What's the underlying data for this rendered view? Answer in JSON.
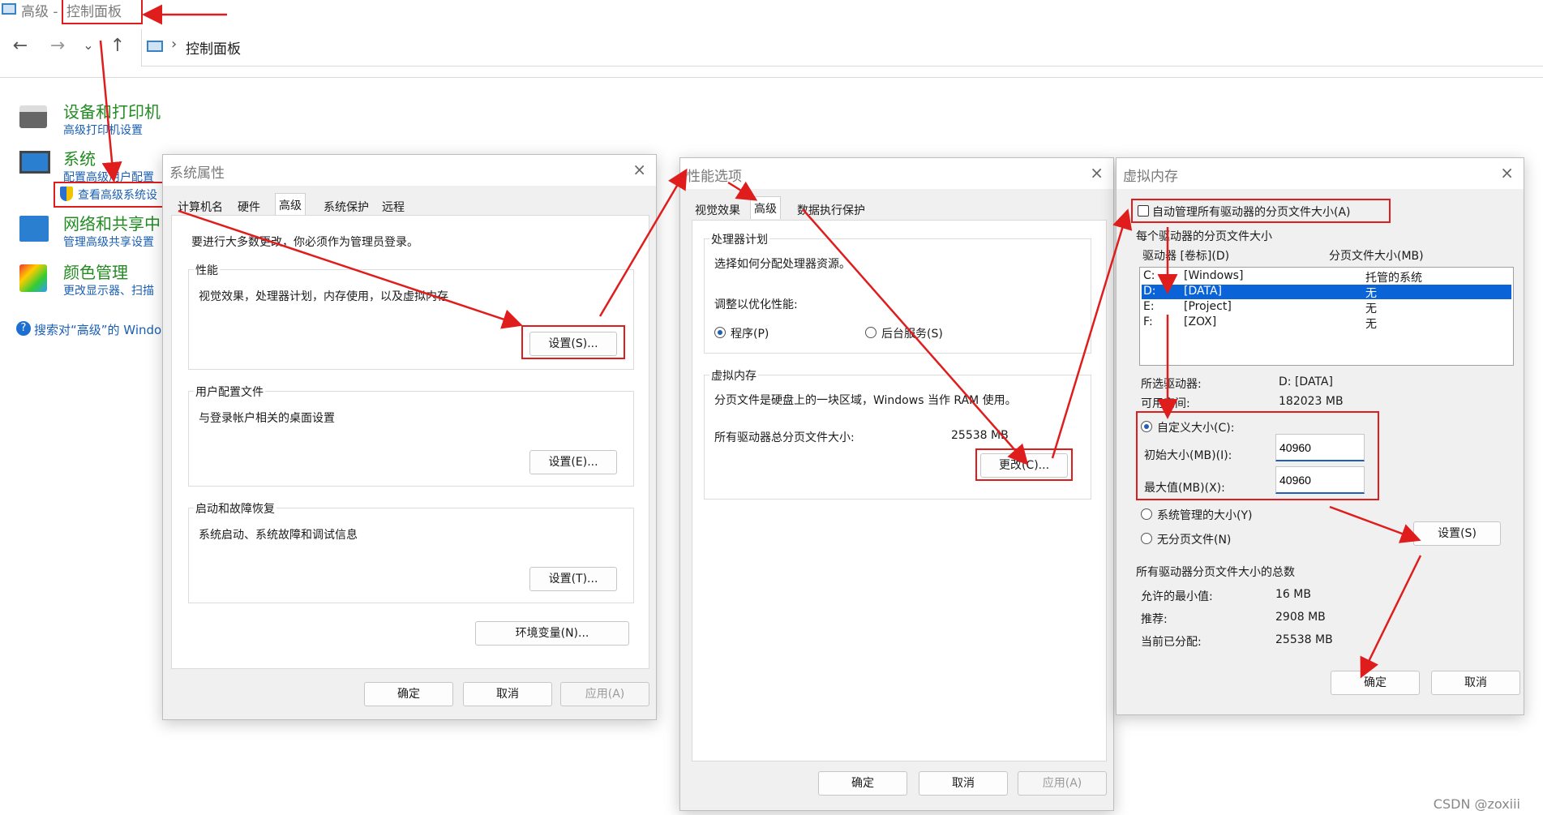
{
  "window": {
    "title_prefix": "高级 -",
    "title": "控制面板"
  },
  "address": {
    "crumb": "控制面板",
    "arrow": "›"
  },
  "nav": {
    "back": "←",
    "forward": "→",
    "dropdown": "⌄",
    "up": "↑"
  },
  "cp": {
    "devices": {
      "title": "设备和打印机",
      "sub": "高级打印机设置"
    },
    "system": {
      "title": "系统",
      "sub1": "配置高级用户配置",
      "sub2": "查看高级系统设"
    },
    "network": {
      "title": "网络和共享中",
      "sub": "管理高级共享设置"
    },
    "color": {
      "title": "颜色管理",
      "sub": "更改显示器、扫描"
    },
    "search": "搜索对“高级”的 Window"
  },
  "sysprops": {
    "title": "系统属性",
    "close": "×",
    "tabs": [
      "计算机名",
      "硬件",
      "高级",
      "系统保护",
      "远程"
    ],
    "admin_note": "要进行大多数更改，你必须作为管理员登录。",
    "perf": {
      "label": "性能",
      "desc": "视觉效果，处理器计划，内存使用，以及虚拟内存",
      "btn": "设置(S)..."
    },
    "profile": {
      "label": "用户配置文件",
      "desc": "与登录帐户相关的桌面设置",
      "btn": "设置(E)..."
    },
    "startup": {
      "label": "启动和故障恢复",
      "desc": "系统启动、系统故障和调试信息",
      "btn": "设置(T)..."
    },
    "env_btn": "环境变量(N)...",
    "ok": "确定",
    "cancel": "取消",
    "apply": "应用(A)"
  },
  "perfopts": {
    "title": "性能选项",
    "close": "×",
    "tabs": [
      "视觉效果",
      "高级",
      "数据执行保护"
    ],
    "sched": {
      "label": "处理器计划",
      "desc": "选择如何分配处理器资源。",
      "adjust": "调整以优化性能:",
      "opt1": "程序(P)",
      "opt2": "后台服务(S)"
    },
    "vm": {
      "label": "虚拟内存",
      "desc": "分页文件是硬盘上的一块区域，Windows 当作 RAM 使用。",
      "total_label": "所有驱动器总分页文件大小:",
      "total_value": "25538 MB",
      "btn": "更改(C)..."
    },
    "ok": "确定",
    "cancel": "取消",
    "apply": "应用(A)"
  },
  "vmem": {
    "title": "虚拟内存",
    "close": "×",
    "auto": "自动管理所有驱动器的分页文件大小(A)",
    "per_drive": "每个驱动器的分页文件大小",
    "col1": "驱动器 [卷标](D)",
    "col2": "分页文件大小(MB)",
    "drives": [
      {
        "d": "C:",
        "label": "[Windows]",
        "size": "托管的系统"
      },
      {
        "d": "D:",
        "label": "[DATA]",
        "size": "无"
      },
      {
        "d": "E:",
        "label": "[Project]",
        "size": "无"
      },
      {
        "d": "F:",
        "label": "[ZOX]",
        "size": "无"
      }
    ],
    "sel_label": "所选驱动器:",
    "sel_value": "D:  [DATA]",
    "free_label": "可用空间:",
    "free_value": "182023 MB",
    "custom": "自定义大小(C):",
    "init_label": "初始大小(MB)(I):",
    "init_value": "40960",
    "max_label": "最大值(MB)(X):",
    "max_value": "40960",
    "sysman": "系统管理的大小(Y)",
    "nopage": "无分页文件(N)",
    "set_btn": "设置(S)",
    "total_title": "所有驱动器分页文件大小的总数",
    "min_label": "允许的最小值:",
    "min_value": "16 MB",
    "rec_label": "推荐:",
    "rec_value": "2908 MB",
    "cur_label": "当前已分配:",
    "cur_value": "25538 MB",
    "ok": "确定",
    "cancel": "取消"
  },
  "watermark": "CSDN @zoxiii",
  "colors": {
    "accent": "#1f5fb8",
    "annotation": "#e01d1d",
    "link": "#1a5fb4",
    "category": "#228b22"
  }
}
